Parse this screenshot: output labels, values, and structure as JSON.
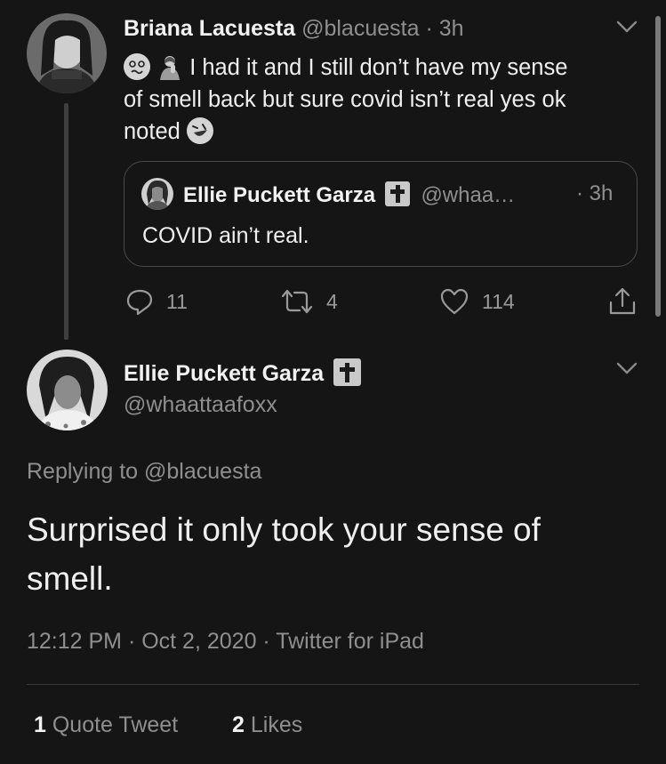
{
  "parent_tweet": {
    "author_name": "Briana Lacuesta",
    "handle": "@blacuesta",
    "separator": "·",
    "time": "3h",
    "text_line1": "I had it and I still don’t have my sense",
    "text_line2": "of smell back but sure covid isn’t real yes ok",
    "text_line3": "noted",
    "quoted": {
      "author_name": "Ellie Puckett Garza",
      "handle": "@whaa…",
      "time": "· 3h",
      "text": "COVID ain’t real."
    },
    "actions": {
      "replies": "11",
      "retweets": "4",
      "likes": "114"
    }
  },
  "main_tweet": {
    "author_name": "Ellie Puckett Garza",
    "handle": "@whaattaafoxx",
    "replying_to": "Replying to @blacuesta",
    "text_line1": "Surprised it only took your sense of",
    "text_line2": "smell.",
    "timestamp": "12:12 PM · Oct 2, 2020 · Twitter for iPad",
    "quote_tweet_count": "1",
    "quote_tweet_label": "Quote Tweet",
    "likes_count": "2",
    "likes_label": "Likes"
  },
  "colors": {
    "background": "#151515",
    "text": "#efefef",
    "muted": "#8f8f8f",
    "border": "#4a4a4a"
  },
  "icons": [
    "reply-icon",
    "retweet-icon",
    "like-icon",
    "share-icon",
    "chevron-down-icon",
    "cross-icon",
    "woozy-face-emoji",
    "person-gesture-emoji",
    "rolling-laughing-emoji"
  ]
}
